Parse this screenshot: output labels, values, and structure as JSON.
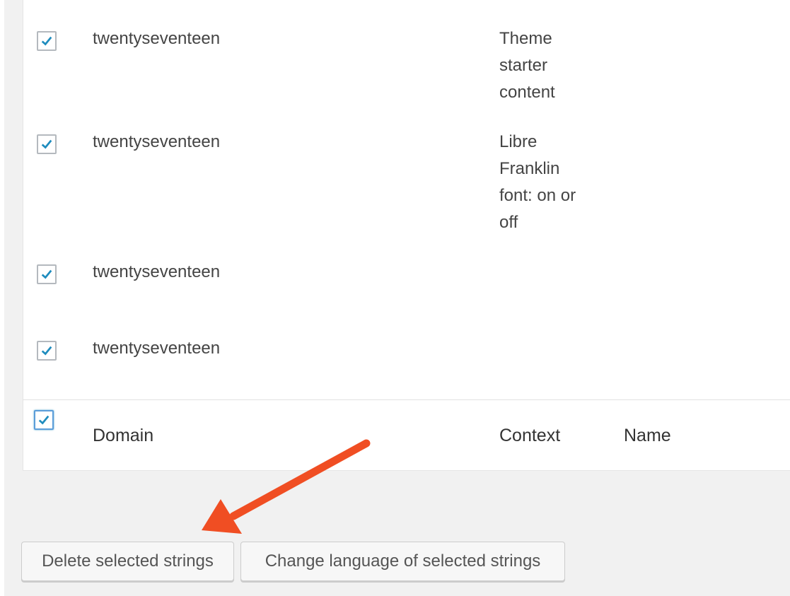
{
  "rows": [
    {
      "domain": "twentyseventeen",
      "context_lines": [
        "Theme",
        "starter",
        "content"
      ],
      "checked": true
    },
    {
      "domain": "twentyseventeen",
      "context_lines": [
        "Libre",
        "Franklin",
        "font: on or",
        "off"
      ],
      "checked": true
    },
    {
      "domain": "twentyseventeen",
      "context_lines": [],
      "checked": true
    },
    {
      "domain": "twentyseventeen",
      "context_lines": [],
      "checked": true
    }
  ],
  "footer": {
    "columns": {
      "domain": "Domain",
      "context": "Context",
      "name": "Name"
    },
    "select_all_checked": true
  },
  "actions": {
    "delete_label": "Delete selected strings",
    "change_language_label": "Change language of selected strings"
  },
  "icons": {
    "checkbox": "checkmark-icon",
    "annotation": "arrow-annotation"
  },
  "colors": {
    "check": "#1e8cbe",
    "arrow": "#f04e23",
    "background": "#f1f1f1"
  }
}
